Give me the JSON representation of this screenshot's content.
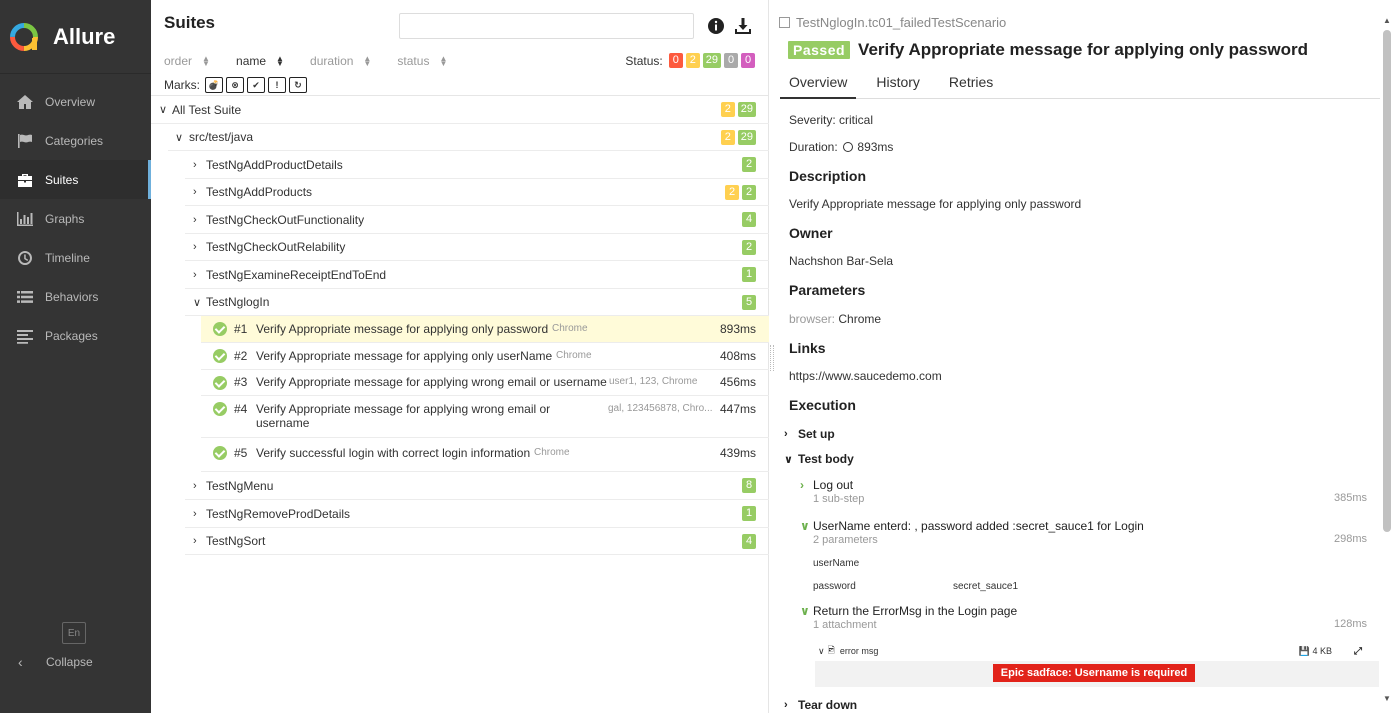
{
  "brand": {
    "name": "Allure"
  },
  "nav": [
    {
      "label": "Overview",
      "icon": "home-icon"
    },
    {
      "label": "Categories",
      "icon": "flag-icon"
    },
    {
      "label": "Suites",
      "icon": "briefcase-icon",
      "active": true
    },
    {
      "label": "Graphs",
      "icon": "bar-chart-icon"
    },
    {
      "label": "Timeline",
      "icon": "clock-icon"
    },
    {
      "label": "Behaviors",
      "icon": "list-icon"
    },
    {
      "label": "Packages",
      "icon": "packages-icon"
    }
  ],
  "sidebar_footer": {
    "lang": "En",
    "collapse": "Collapse"
  },
  "suites": {
    "title": "Suites",
    "search_value": "",
    "sort": [
      {
        "label": "order",
        "active": false
      },
      {
        "label": "name",
        "active": true
      },
      {
        "label": "duration",
        "active": false
      },
      {
        "label": "status",
        "active": false
      }
    ],
    "status_label": "Status:",
    "status_counts": [
      {
        "value": "0",
        "type": "failed"
      },
      {
        "value": "2",
        "type": "broken"
      },
      {
        "value": "29",
        "type": "passed"
      },
      {
        "value": "0",
        "type": "skipped"
      },
      {
        "value": "0",
        "type": "unknown"
      }
    ],
    "marks_label": "Marks:",
    "tree": {
      "root": {
        "name": "All Test Suite",
        "broken": "2",
        "passed": "29"
      },
      "package": {
        "name": "src/test/java",
        "broken": "2",
        "passed": "29"
      },
      "suites_before": [
        {
          "name": "TestNgAddProductDetails",
          "broken": "",
          "passed": "2"
        },
        {
          "name": "TestNgAddProducts",
          "broken": "2",
          "passed": "2"
        },
        {
          "name": "TestNgCheckOutFunctionality",
          "broken": "",
          "passed": "4"
        },
        {
          "name": "TestNgCheckOutRelability",
          "broken": "",
          "passed": "2"
        },
        {
          "name": "TestNgExamineReceiptEndToEnd",
          "broken": "",
          "passed": "1"
        }
      ],
      "expanded_suite": {
        "name": "TestNglogIn",
        "passed": "5"
      },
      "cases": [
        {
          "num": "#1",
          "name": "Verify Appropriate message for applying only password",
          "params": "Chrome",
          "duration": "893ms",
          "selected": true
        },
        {
          "num": "#2",
          "name": "Verify Appropriate message for applying only userName",
          "params": "Chrome",
          "duration": "408ms"
        },
        {
          "num": "#3",
          "name": "Verify Appropriate message for applying wrong email or username",
          "params": "user1, 123, Chrome",
          "duration": "456ms"
        },
        {
          "num": "#4",
          "name": "Verify Appropriate message for applying wrong email or username",
          "params": "gal, 123456878, Chro...",
          "duration": "447ms"
        },
        {
          "num": "#5",
          "name": "Verify successful login with correct login information",
          "params": "Chrome",
          "duration": "439ms"
        }
      ],
      "suites_after": [
        {
          "name": "TestNgMenu",
          "passed": "8"
        },
        {
          "name": "TestNgRemoveProdDetails",
          "passed": "1"
        },
        {
          "name": "TestNgSort",
          "passed": "4"
        }
      ]
    }
  },
  "detail": {
    "breadcrumb": "TestNglogIn.tc01_failedTestScenario",
    "status": "Passed",
    "title": "Verify Appropriate message for applying only password",
    "tabs": [
      "Overview",
      "History",
      "Retries"
    ],
    "severity": "Severity: critical",
    "duration_label": "Duration:",
    "duration": "893ms",
    "description_title": "Description",
    "description": "Verify Appropriate message for applying only password",
    "owner_title": "Owner",
    "owner": "Nachshon Bar-Sela",
    "parameters_title": "Parameters",
    "param_key": "browser:",
    "param_value": "Chrome",
    "links_title": "Links",
    "link": "https://www.saucedemo.com",
    "execution_title": "Execution",
    "setup": "Set up",
    "test_body": "Test body",
    "steps": [
      {
        "title": "Log out",
        "sub": "1 sub-step",
        "duration": "385ms"
      },
      {
        "title": "UserName enterd: , password added :secret_sauce1 for Login",
        "sub": "2 parameters",
        "duration": "298ms"
      },
      {
        "title": "Return the ErrorMsg in the Login page",
        "sub": "1 attachment",
        "duration": "128ms"
      }
    ],
    "step_params": [
      {
        "name": "userName",
        "value": ""
      },
      {
        "name": "password",
        "value": "secret_sauce1"
      }
    ],
    "attachment": {
      "name": "error msg",
      "size": "4 KB"
    },
    "error_message": "Epic sadface: Username is required",
    "teardown": "Tear down"
  }
}
